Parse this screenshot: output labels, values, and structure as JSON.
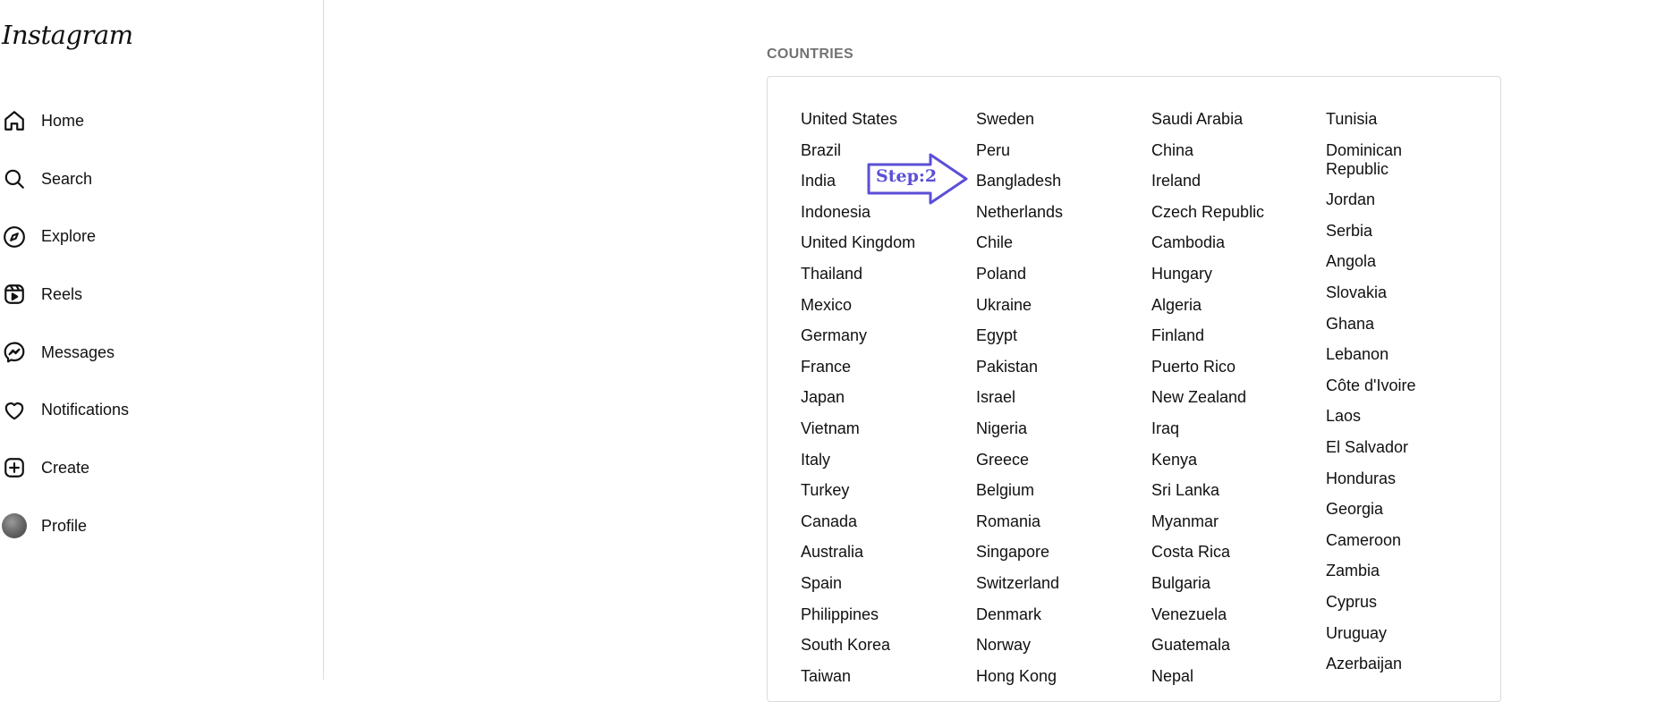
{
  "sidebar": {
    "logo": "Instagram",
    "items": [
      {
        "label": "Home",
        "icon": "home-icon"
      },
      {
        "label": "Search",
        "icon": "search-icon"
      },
      {
        "label": "Explore",
        "icon": "compass-icon"
      },
      {
        "label": "Reels",
        "icon": "reels-icon"
      },
      {
        "label": "Messages",
        "icon": "messenger-icon"
      },
      {
        "label": "Notifications",
        "icon": "heart-icon"
      },
      {
        "label": "Create",
        "icon": "plus-square-icon"
      },
      {
        "label": "Profile",
        "icon": "avatar"
      }
    ]
  },
  "main": {
    "section_title": "COUNTRIES",
    "columns": [
      [
        "United States",
        "Brazil",
        "India",
        "Indonesia",
        "United Kingdom",
        "Thailand",
        "Mexico",
        "Germany",
        "France",
        "Japan",
        "Vietnam",
        "Italy",
        "Turkey",
        "Canada",
        "Australia",
        "Spain",
        "Philippines",
        "South Korea",
        "Taiwan"
      ],
      [
        "Sweden",
        "Peru",
        "Bangladesh",
        "Netherlands",
        "Chile",
        "Poland",
        "Ukraine",
        "Egypt",
        "Pakistan",
        "Israel",
        "Nigeria",
        "Greece",
        "Belgium",
        "Romania",
        "Singapore",
        "Switzerland",
        "Denmark",
        "Norway",
        "Hong Kong"
      ],
      [
        "Saudi Arabia",
        "China",
        "Ireland",
        "Czech Republic",
        "Cambodia",
        "Hungary",
        "Algeria",
        "Finland",
        "Puerto Rico",
        "New Zealand",
        "Iraq",
        "Kenya",
        "Sri Lanka",
        "Myanmar",
        "Costa Rica",
        "Bulgaria",
        "Venezuela",
        "Guatemala",
        "Nepal"
      ],
      [
        "Tunisia",
        "Dominican Republic",
        "Jordan",
        "Serbia",
        "Angola",
        "Slovakia",
        "Ghana",
        "Lebanon",
        "Côte d'Ivoire",
        "Laos",
        "El Salvador",
        "Honduras",
        "Georgia",
        "Cameroon",
        "Zambia",
        "Cyprus",
        "Uruguay",
        "Azerbaijan"
      ]
    ]
  },
  "annotation": {
    "step_label": "Step:2",
    "color": "#5b4fd6"
  }
}
